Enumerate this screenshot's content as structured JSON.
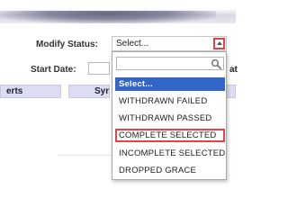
{
  "form": {
    "modify_status_label": "Modify Status:",
    "start_date_label": "Start Date:",
    "start_date_value": "",
    "right_cut_label": "at"
  },
  "tabs": [
    {
      "label": "erts"
    },
    {
      "label": "Sync"
    },
    {
      "label": "/"
    }
  ],
  "status_select": {
    "value": "Select...",
    "search_value": "",
    "options": [
      {
        "label": "Select..."
      },
      {
        "label": "WITHDRAWN FAILED"
      },
      {
        "label": "WITHDRAWN PASSED"
      },
      {
        "label": "COMPLETE SELECTED"
      },
      {
        "label": "INCOMPLETE SELECTED"
      },
      {
        "label": "DROPPED GRACE"
      }
    ],
    "selected_index": 0,
    "highlighted_index": 3
  },
  "colors": {
    "selected_bg": "#3465c8",
    "highlight_border": "#e04444",
    "tab_bg": "#dcdcf2"
  },
  "icons": {
    "search": "search-icon",
    "arrow": "chevron-up-icon"
  }
}
